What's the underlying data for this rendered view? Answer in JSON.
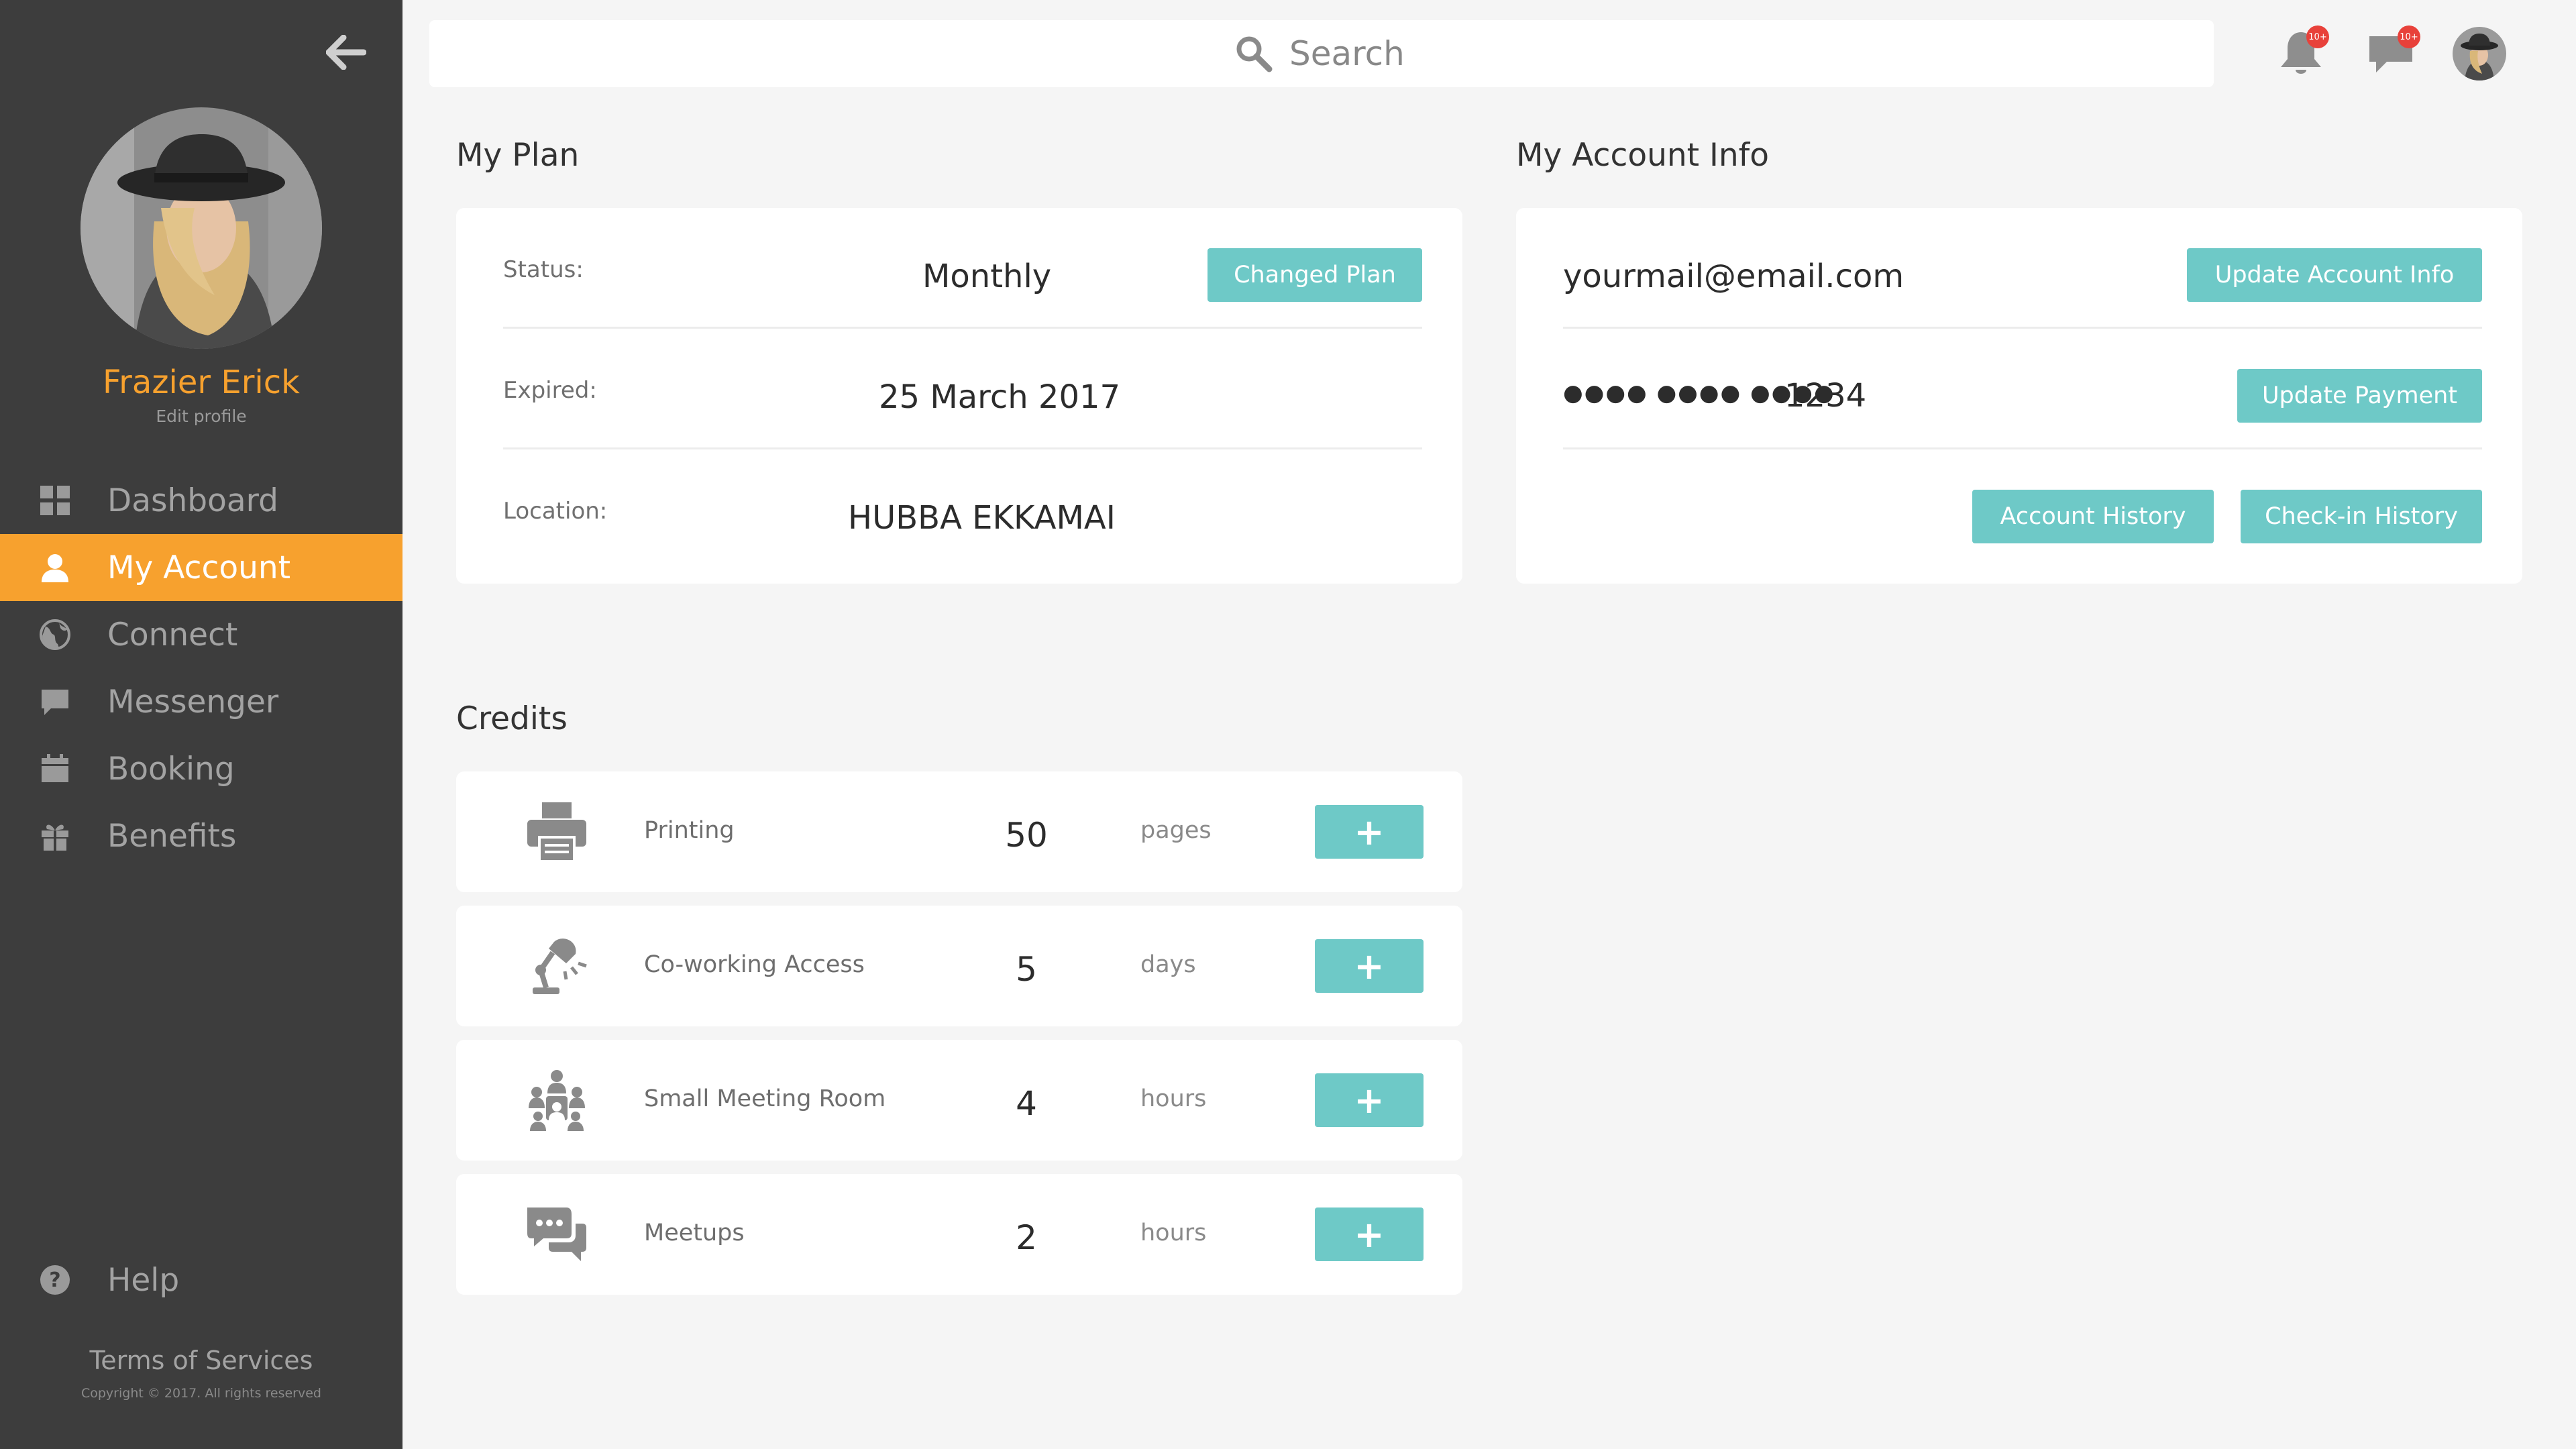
{
  "colors": {
    "accent": "#f7a12e",
    "button": "#6ec9c7",
    "sidebar": "#3d3d3d",
    "badge": "#e8413a"
  },
  "sidebar": {
    "profile_name": "Frazier Erick",
    "edit_profile": "Edit profile",
    "items": [
      {
        "label": "Dashboard",
        "icon": "grid-icon"
      },
      {
        "label": "My Account",
        "icon": "user-icon",
        "active": true
      },
      {
        "label": "Connect",
        "icon": "globe-icon"
      },
      {
        "label": "Messenger",
        "icon": "chat-icon"
      },
      {
        "label": "Booking",
        "icon": "calendar-icon"
      },
      {
        "label": "Benefits",
        "icon": "gift-icon"
      }
    ],
    "help": "Help",
    "terms": "Terms of Services",
    "copyright": "Copyright © 2017. All rights reserved"
  },
  "topbar": {
    "search_placeholder": "Search",
    "notifications_badge": "10+",
    "messages_badge": "10+"
  },
  "plan": {
    "title": "My Plan",
    "status_label": "Status:",
    "status_value": "Monthly",
    "change_button": "Changed Plan",
    "expired_label": "Expired:",
    "expired_value": "25 March 2017",
    "location_label": "Location:",
    "location_value": "HUBBA EKKAMAI"
  },
  "account": {
    "title": "My Account Info",
    "email": "yourmail@email.com",
    "update_info_button": "Update Account Info",
    "card_masked": "●●●● ●●●● ●●●●",
    "card_last4": "1234",
    "update_payment_button": "Update Payment",
    "history_button": "Account History",
    "checkin_button": "Check-in History"
  },
  "credits": {
    "title": "Credits",
    "items": [
      {
        "name": "Printing",
        "value": "50",
        "unit": "pages",
        "icon": "printer-icon"
      },
      {
        "name": "Co-working Access",
        "value": "5",
        "unit": "days",
        "icon": "desk-lamp-icon"
      },
      {
        "name": "Small Meeting Room",
        "value": "4",
        "unit": "hours",
        "icon": "meeting-room-icon"
      },
      {
        "name": "Meetups",
        "value": "2",
        "unit": "hours",
        "icon": "meetup-chat-icon"
      }
    ],
    "add_label": "+"
  }
}
